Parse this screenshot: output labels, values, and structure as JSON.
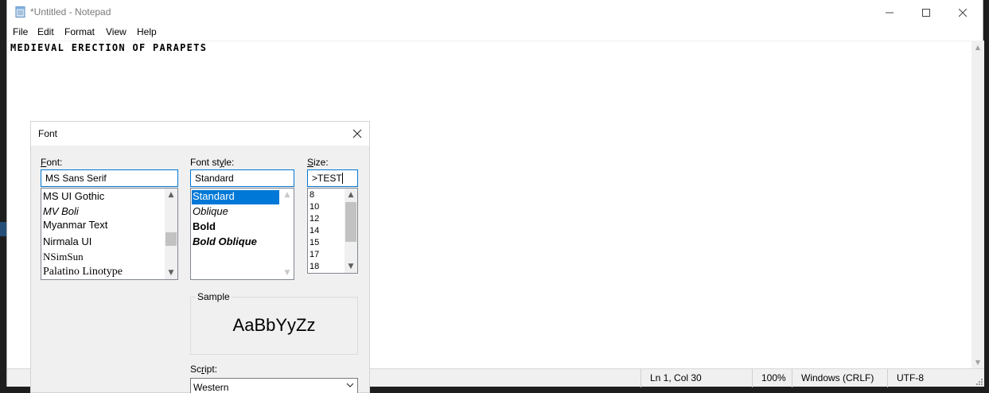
{
  "window": {
    "title": "*Untitled - Notepad",
    "controls": {
      "minimize": "—",
      "maximize": "☐",
      "close": "✕"
    }
  },
  "menu": {
    "file": "File",
    "edit": "Edit",
    "format": "Format",
    "view": "View",
    "help": "Help"
  },
  "editor": {
    "content": "MEDIEVAL ERECTION OF PARAPETS"
  },
  "status": {
    "position": "Ln 1, Col 30",
    "zoom": "100%",
    "line_ending": "Windows (CRLF)",
    "encoding": "UTF-8"
  },
  "font_dialog": {
    "title": "Font",
    "close": "✕",
    "font_label_accel": "F",
    "font_label_rest": "ont:",
    "style_label_pre": "Font st",
    "style_label_accel": "y",
    "style_label_post": "le:",
    "size_label_accel": "S",
    "size_label_rest": "ize:",
    "font_value": "MS Sans Serif",
    "style_value": "Standard",
    "size_value": ">TEST",
    "font_list": [
      "MS UI Gothic",
      "MV Boli",
      "Myanmar Text",
      "Nirmala UI",
      "NSimSun",
      "Palatino Linotype"
    ],
    "style_list": [
      "Standard",
      "Oblique",
      "Bold",
      "Bold Oblique"
    ],
    "selected_style": "Standard",
    "size_list": [
      "8",
      "10",
      "12",
      "14",
      "15",
      "17",
      "18"
    ],
    "sample_label": "Sample",
    "sample_text": "AaBbYyZz",
    "script_label_pre": "Sc",
    "script_label_accel": "r",
    "script_label_post": "ipt:",
    "script_value": "Western"
  }
}
